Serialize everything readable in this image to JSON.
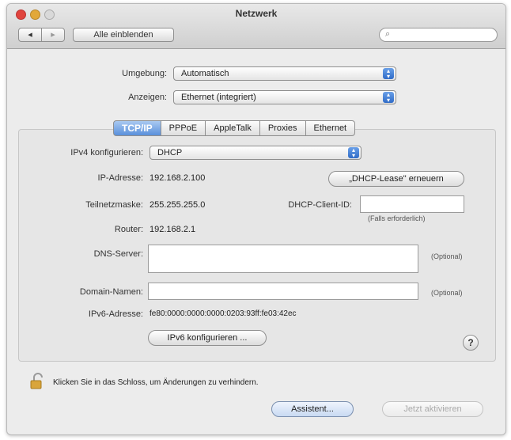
{
  "window": {
    "title": "Netzwerk"
  },
  "toolbar": {
    "back": "◂",
    "forward": "▸",
    "show_all": "Alle einblenden"
  },
  "search": {
    "placeholder": "",
    "icon": "magnifier-icon"
  },
  "location": {
    "label": "Umgebung:",
    "value": "Automatisch"
  },
  "show": {
    "label": "Anzeigen:",
    "value": "Ethernet (integriert)"
  },
  "tabs": [
    "TCP/IP",
    "PPPoE",
    "AppleTalk",
    "Proxies",
    "Ethernet"
  ],
  "tcpip": {
    "configure_ipv4": {
      "label": "IPv4 konfigurieren:",
      "value": "DHCP"
    },
    "ip": {
      "label": "IP-Adresse:",
      "value": "192.168.2.100"
    },
    "renew_button": "„DHCP-Lease\" erneuern",
    "subnet": {
      "label": "Teilnetzmaske:",
      "value": "255.255.255.0"
    },
    "client_id": {
      "label": "DHCP-Client-ID:",
      "value": "",
      "hint": "(Falls erforderlich)"
    },
    "router": {
      "label": "Router:",
      "value": "192.168.2.1"
    },
    "dns": {
      "label": "DNS-Server:",
      "value": "",
      "optional": "(Optional)"
    },
    "domains": {
      "label": "Domain-Namen:",
      "value": "",
      "optional": "(Optional)"
    },
    "ipv6_address": {
      "label": "IPv6-Adresse:",
      "value": "fe80:0000:0000:0000:0203:93ff:fe03:42ec"
    },
    "configure_ipv6_button": "IPv6 konfigurieren ...",
    "help": "?"
  },
  "footer": {
    "lock_text": "Klicken Sie in das Schloss, um Änderungen zu verhindern.",
    "assistant_button": "Assistent...",
    "apply_button": "Jetzt aktivieren"
  },
  "colors": {
    "accent": "#5a90db",
    "close": "#e0443e",
    "minimize": "#e2a83a"
  }
}
